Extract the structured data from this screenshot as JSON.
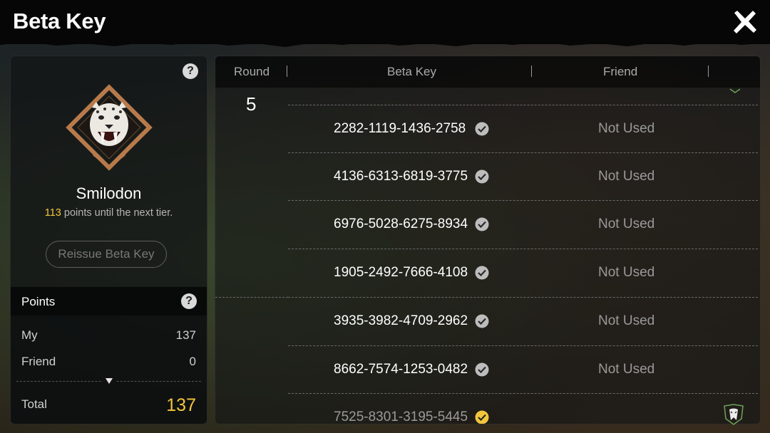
{
  "header": {
    "title": "Beta Key"
  },
  "tier": {
    "name": "Smilodon",
    "points_needed": "113",
    "points_suffix": " points until the next tier.",
    "emblem": "sabertooth-emblem-icon"
  },
  "reissue_label": "Reissue Beta Key",
  "points": {
    "title": "Points",
    "my_label": "My",
    "my_value": "137",
    "friend_label": "Friend",
    "friend_value": "0",
    "total_label": "Total",
    "total_value": "137"
  },
  "table": {
    "headers": [
      "Round",
      "Beta Key",
      "Friend"
    ],
    "round": "5",
    "rows": [
      {
        "key": "2282-1119-1436-2758",
        "status": "Not Used"
      },
      {
        "key": "4136-6313-6819-3775",
        "status": "Not Used"
      },
      {
        "key": "6976-5028-6275-8934",
        "status": "Not Used"
      },
      {
        "key": "1905-2492-7666-4108",
        "status": "Not Used"
      },
      {
        "key": "3935-3982-4709-2962",
        "status": "Not Used"
      },
      {
        "key": "8662-7574-1253-0482",
        "status": "Not Used"
      },
      {
        "key": "7525-8301-3195-5445",
        "status": ""
      }
    ]
  },
  "colors": {
    "accent": "#f2c63c",
    "emblem_bronze": "#b87a4b"
  }
}
